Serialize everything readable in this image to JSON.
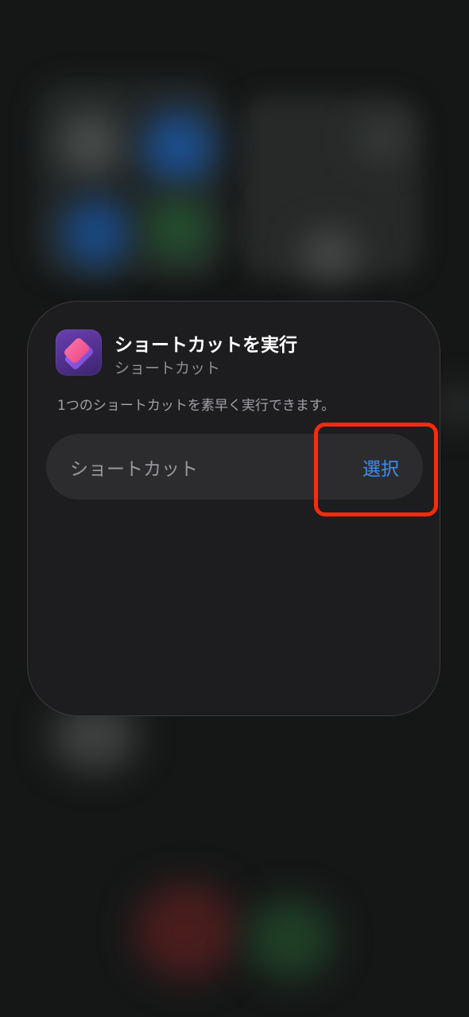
{
  "widget": {
    "title": "ショートカットを実行",
    "subtitle": "ショートカット",
    "description": "1つのショートカットを素早く実行できます。",
    "parameter_label": "ショートカット",
    "select_label": "選択",
    "app_icon": "shortcuts-app-icon"
  },
  "colors": {
    "background": "#151717",
    "card": "#1d1d20",
    "accent": "#3d8ef0",
    "highlight": "#ff2a0c"
  }
}
